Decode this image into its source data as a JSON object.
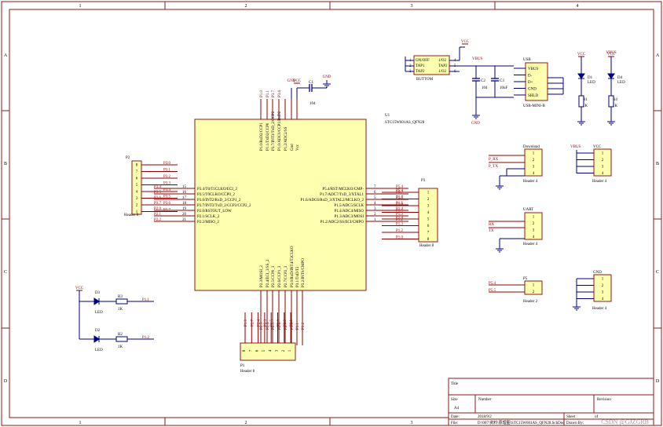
{
  "frame": {
    "cols": [
      "1",
      "2",
      "3",
      "4"
    ],
    "rows": [
      "A",
      "B",
      "C",
      "D"
    ]
  },
  "mcu": {
    "designator": "U1",
    "part": "STC15W601AS_QFN28",
    "top_pins": [
      "P1.0/RxD2/CCP1",
      "P1.1/TxD2/CCP0",
      "P3.7/INT3/TxD_2/CCP2",
      "P1.0/ADC0/CCP1/RxD2",
      "P1.2/ADC2/SS",
      "Gnd",
      "Vcc"
    ],
    "left_pins": [
      "P3.4/T0/T1CLKO/ECI_2",
      "P3.5/T0CLKO/CCP0_2",
      "P3.6/INT2/RxD_2/CCP1_2",
      "P3.7/INT3/TxD_2/CCP2/CCP2_2",
      "P2.0/RSTOUT_LOW",
      "P2.1/SCLK_2",
      "P2.2/MISO_2"
    ],
    "left_nums": [
      "15",
      "16",
      "17",
      "18",
      "19",
      "20",
      "21"
    ],
    "right_pins": [
      "P5.4/RST/MCLKO/CMP-",
      "P1.7/ADC7/TxD_3/XTAL1",
      "P1.6/ADC6/RxD_3/XTAL2/MCLKO_2",
      "P1.5/ADC5/SCLK",
      "P1.4/ADC4/MISO",
      "P1.3/ADC3/MOSI",
      "P1.2/ADC2/SS/ECI/CMPO"
    ],
    "right_nums": [
      "7",
      "6",
      "5",
      "4",
      "3",
      "2",
      "1"
    ],
    "bottom_pins": [
      "P2.3/MOSI_2",
      "P2.4/ECI_3/SS_2",
      "P2.5/CCP0_3",
      "P2.6/CCP1_3",
      "P2.7/CCP2_3",
      "P3.0/RxD/INT4/T2CLKO",
      "P3.1/TxD/T2",
      "P3.2/INT0/CMPO"
    ]
  },
  "nets": {
    "left": [
      "P3.4",
      "P3.5",
      "P3.6",
      "P3.7",
      "P2.0",
      "P2.1",
      "P2.2"
    ],
    "right": [
      "P5.4",
      "P1.7",
      "P1.6",
      "P1.5",
      "P1.4",
      "P1.3",
      "P1.2"
    ],
    "top": [
      "P1.0",
      "P1.1",
      "P3.7",
      "P3.6"
    ],
    "bottom": [
      "P2.3",
      "P2.4",
      "P2.5",
      "P2.6",
      "P2.7",
      "P3.0",
      "P3.1",
      "P3.2"
    ],
    "p2_header": [
      "P3.0",
      "P3.1",
      "P3.2",
      "P3.3",
      "P3.4",
      "P3.5",
      "P3.6",
      "P3.7"
    ],
    "p3_header": [
      "P5.4",
      "P1.7",
      "P1.6",
      "P1.5",
      "P1.4",
      "P1.3",
      "P1.2",
      "P1.0"
    ]
  },
  "cap_c1": {
    "designator": "C1",
    "value": "104"
  },
  "labels": {
    "vcc": "VCC",
    "gnd": "GND",
    "vbus": "VBUS",
    "header8": "Header 8",
    "header4": "Header 4",
    "header2": "Header 2"
  },
  "headers": {
    "p2": {
      "designator": "P2",
      "pins": [
        "8",
        "7",
        "6",
        "5",
        "4",
        "3",
        "2",
        "1"
      ]
    },
    "p3": {
      "designator": "P3",
      "pins": [
        "1",
        "2",
        "3",
        "4",
        "5",
        "6",
        "7",
        "8"
      ]
    },
    "p1": {
      "designator": "P1",
      "pins": [
        "8",
        "7",
        "6",
        "5",
        "4",
        "3",
        "2",
        "1"
      ]
    },
    "download": {
      "title": "Download",
      "nets": [
        "P_RX",
        "P_TX"
      ],
      "pins": [
        "1",
        "2",
        "3",
        "4"
      ]
    },
    "vcc_hdr": {
      "title": "VCC",
      "net": "VBUS",
      "pins": [
        "1",
        "2",
        "3",
        "4"
      ]
    },
    "uart": {
      "title": "UART",
      "nets": [
        "RX",
        "TX"
      ],
      "pins": [
        "1",
        "2",
        "3",
        "4"
      ]
    },
    "p5": {
      "designator": "P5",
      "nets": [
        "P5.4",
        "P5.5"
      ],
      "pins": [
        "1",
        "2"
      ]
    },
    "gnd_hdr": {
      "title": "GND",
      "pins": [
        "1",
        "2",
        "3",
        "4"
      ]
    }
  },
  "button": {
    "name": "BUTTOM",
    "pins": [
      "ON/OFF",
      "TAP1",
      "TAP2"
    ],
    "right": [
      "1/O2",
      "TAP2",
      "1/O2"
    ],
    "nums_left": [
      "1",
      "2",
      "3"
    ],
    "nums_right": [
      "4",
      "5",
      "6"
    ]
  },
  "usb": {
    "title": "USB",
    "part": "USB-MINI-B",
    "pins": [
      "VBUS",
      "D-",
      "D+",
      "GND",
      "SHLD"
    ],
    "cap_c2": {
      "designator": "C2",
      "value": "104"
    },
    "cap_c3": {
      "designator": "C3",
      "value": "10uF"
    }
  },
  "leds_top": [
    {
      "led": "D1",
      "type": "LED",
      "res": "R1",
      "val": "1K"
    },
    {
      "led": "D4",
      "type": "LED",
      "res": "R4",
      "val": "1K"
    }
  ],
  "leds_bottom": [
    {
      "led": "D3",
      "type": "LED",
      "res": "R3",
      "val": "1K",
      "net": "P1.1"
    },
    {
      "led": "D2",
      "type": "LED",
      "res": "R2",
      "val": "1K",
      "net": "P1.2"
    }
  ],
  "title_block": {
    "title": "Title",
    "size": "Size",
    "size_val": "A4",
    "number": "Number",
    "revision": "Revision",
    "date": "Date:",
    "date_val": "2018/9/2",
    "file": "File:",
    "file_val": "D:\\007\\资料\\原理图\\STC15W601AS_QFN28.SchDoc",
    "sheet": "Sheet",
    "of": "of",
    "drawn": "Drawn By:"
  },
  "watermark": "CSDN @GJZGRB",
  "colors": {
    "border": "#8b1a1a",
    "wire": "#000080",
    "body": "#ffffb0",
    "net": "#8b0000",
    "text": "#000000"
  }
}
